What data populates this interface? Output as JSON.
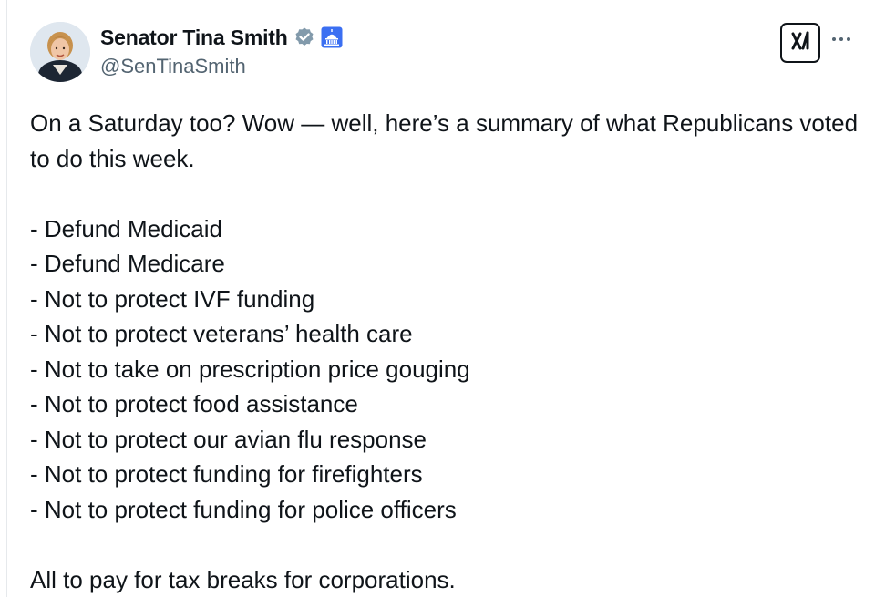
{
  "author": {
    "display_name": "Senator Tina Smith",
    "handle": "@SenTinaSmith",
    "badges": [
      "verified-badge-icon",
      "capitol-icon"
    ]
  },
  "toolbar": {
    "grok_icon": "grok-icon",
    "more_icon": "more-icon"
  },
  "tweet": {
    "intro": "On a Saturday too? Wow — well, here’s a summary of what Republicans voted to do this week.",
    "items": [
      "- Defund Medicaid",
      "- Defund Medicare",
      "- Not to protect IVF funding",
      "- Not to protect veterans’ health care",
      "- Not to take on prescription price gouging",
      "- Not to protect food assistance",
      "- Not to protect our avian flu response",
      "- Not to protect funding for firefighters",
      "- Not to protect funding for police officers"
    ],
    "outro": "All to pay for tax breaks for corporations."
  },
  "colors": {
    "text": "#0f1419",
    "secondary": "#536471",
    "verified_badge": "#829aab",
    "capitol_blue": "#3b6ff2"
  }
}
